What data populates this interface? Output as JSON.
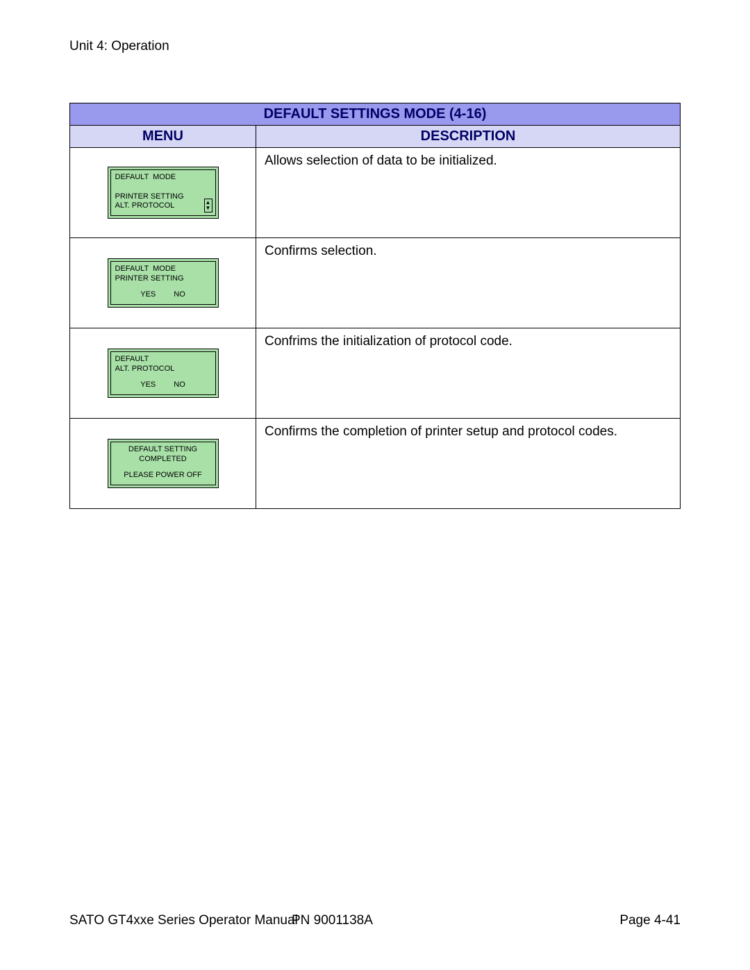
{
  "header": {
    "unit_label": "Unit 4:  Operation"
  },
  "table": {
    "title": "DEFAULT SETTINGS MODE (4-16)",
    "col_menu": "MENU",
    "col_desc": "DESCRIPTION",
    "rows": [
      {
        "lcd": {
          "line1": "DEFAULT  MODE",
          "line2": "",
          "line3": "PRINTER SETTING",
          "line4": "ALT. PROTOCOL",
          "has_arrows": true
        },
        "description": "Allows selection of data to be initialized."
      },
      {
        "lcd": {
          "line1": "DEFAULT  MODE",
          "line2": "PRINTER SETTING",
          "yes": "YES",
          "no": "NO"
        },
        "description": "Confirms selection."
      },
      {
        "lcd": {
          "line1": "DEFAULT",
          "line2": "ALT. PROTOCOL",
          "yes": "YES",
          "no": "NO"
        },
        "description": "Confrims the initialization of protocol code."
      },
      {
        "lcd": {
          "center1": "DEFAULT SETTING",
          "center2": "COMPLETED",
          "center3": "PLEASE POWER OFF"
        },
        "description": "Confirms the completion of printer setup and protocol codes."
      }
    ]
  },
  "footer": {
    "left": "SATO GT4xxe Series Operator Manual",
    "center": "PN 9001138A",
    "right": "Page 4-41"
  }
}
